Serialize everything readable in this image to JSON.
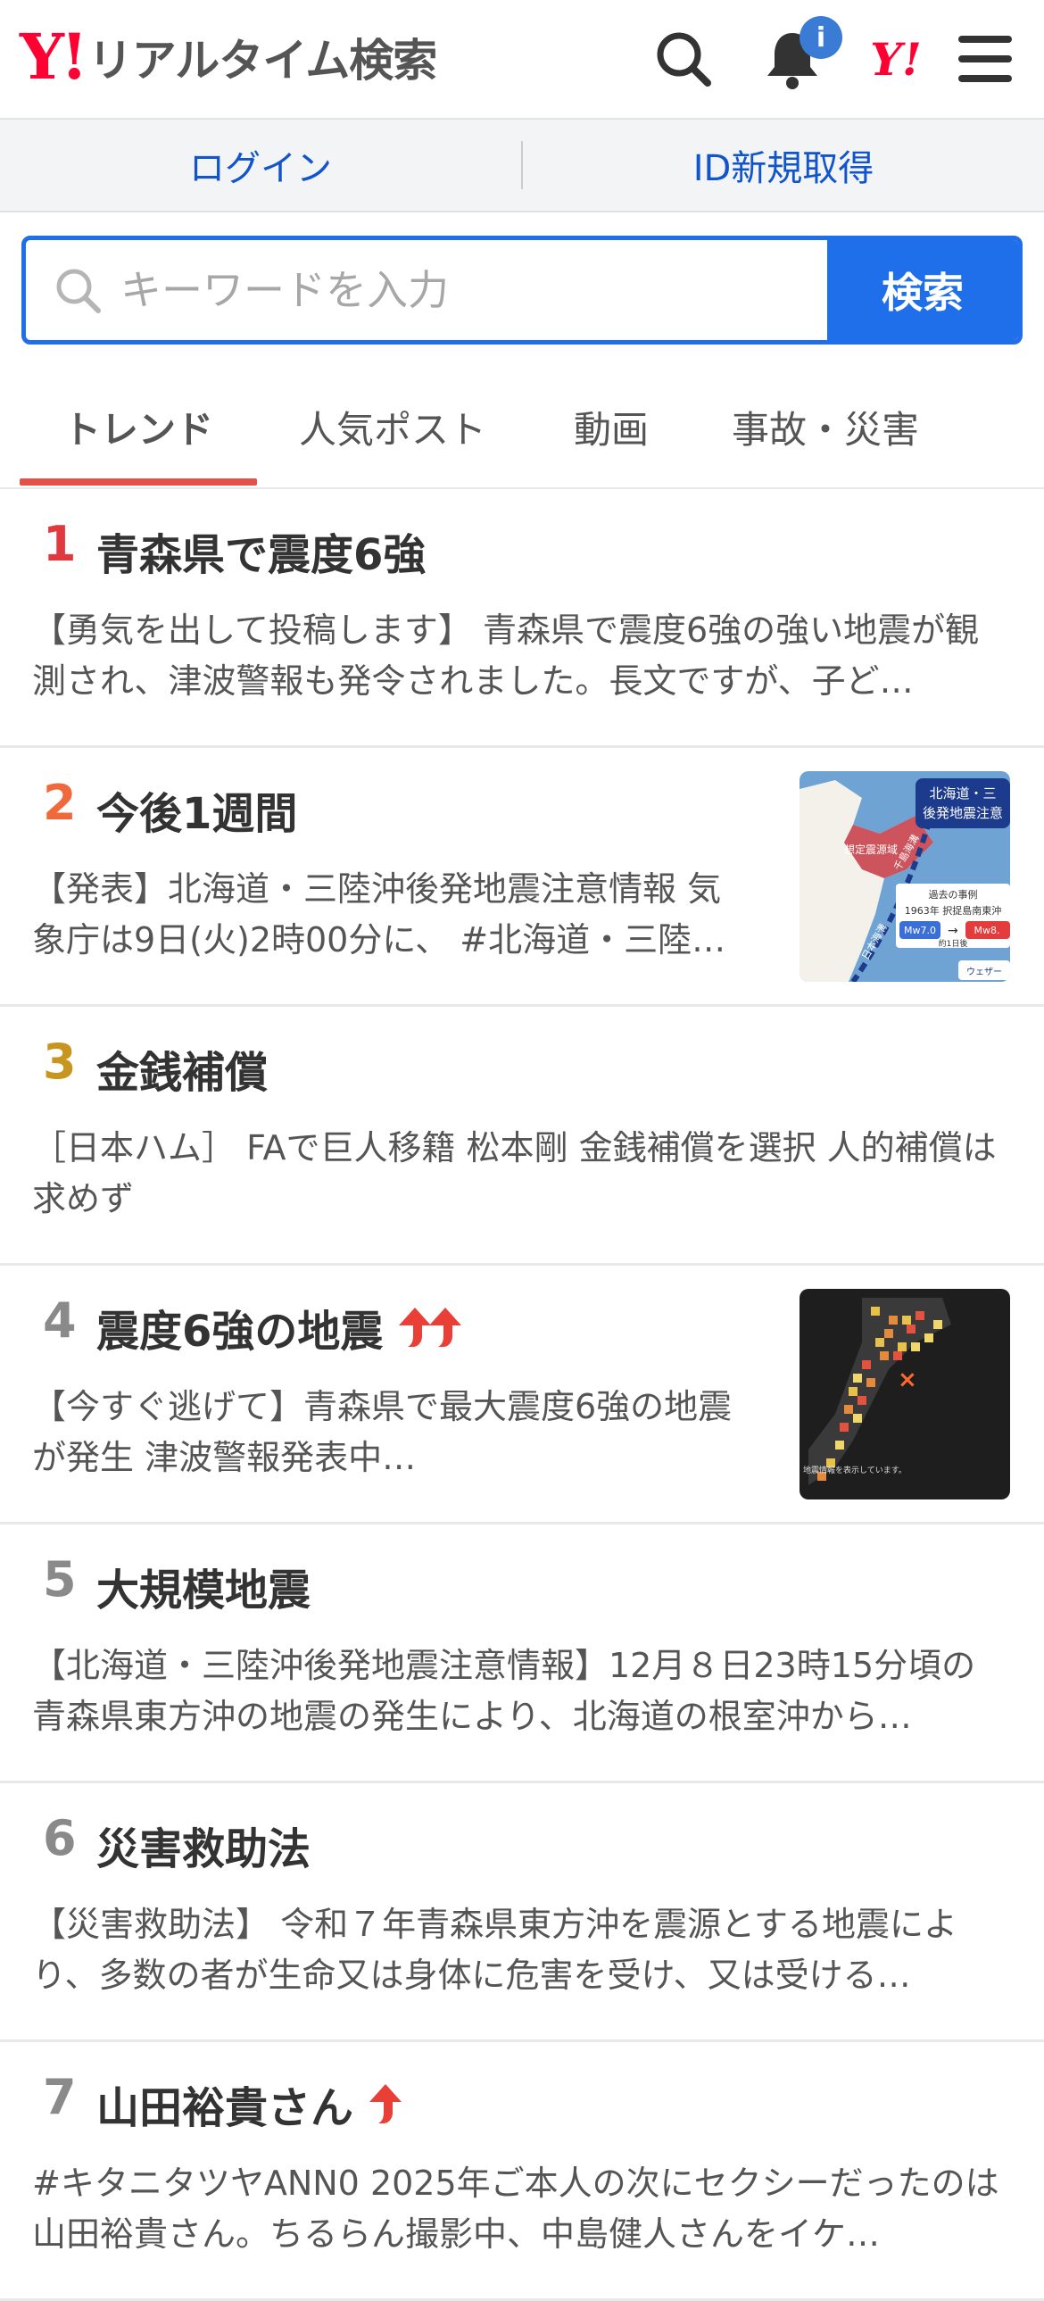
{
  "header": {
    "logo_mark": "Y!",
    "logo_text": "リアルタイム検索",
    "notification_badge": "i",
    "yahoo_small": "Y!"
  },
  "login_bar": {
    "login": "ログイン",
    "register": "ID新規取得"
  },
  "search": {
    "placeholder": "キーワードを入力",
    "button": "検索"
  },
  "tabs": [
    {
      "label": "トレンド",
      "active": true
    },
    {
      "label": "人気ポスト",
      "active": false
    },
    {
      "label": "動画",
      "active": false
    },
    {
      "label": "事故・災害",
      "active": false
    }
  ],
  "colors": {
    "accent": "#1f6feb",
    "brand_red": "#ff0033",
    "rank1": "#e0393e",
    "rank2": "#f0693c",
    "rank3": "#c8961e",
    "rank_other": "#8a8a8a",
    "trend_arrow": "#ea3f36"
  },
  "trends": [
    {
      "rank": "1",
      "title": "青森県で震度6強",
      "desc": "【勇気を出して投稿します】 青森県で震度6強の強い地震が観測され、津波警報も発令されました。長文ですが、子ど…",
      "arrows": 0,
      "thumb": "none"
    },
    {
      "rank": "2",
      "title": "今後1週間",
      "desc": "【発表】北海道・三陸沖後発地震注意情報 気象庁は9日(火)2時00分に、 #北海道・三陸…",
      "arrows": 0,
      "thumb": "map"
    },
    {
      "rank": "3",
      "title": "金銭補償",
      "desc": "［日本ハム］ FAで巨人移籍 松本剛 金銭補償を選択 人的補償は求めず",
      "arrows": 0,
      "thumb": "none"
    },
    {
      "rank": "4",
      "title": "震度6強の地震",
      "desc": "【今すぐ逃げて】青森県で最大震度6強の地震が発生 津波警報発表中…",
      "arrows": 2,
      "thumb": "quake"
    },
    {
      "rank": "5",
      "title": "大規模地震",
      "desc": "【北海道・三陸沖後発地震注意情報】12月８日23時15分頃の青森県東方沖の地震の発生により、北海道の根室沖から…",
      "arrows": 0,
      "thumb": "none"
    },
    {
      "rank": "6",
      "title": "災害救助法",
      "desc": "【災害救助法】 令和７年青森県東方沖を震源とする地震により、多数の者が生命又は身体に危害を受け、又は受ける…",
      "arrows": 0,
      "thumb": "none"
    },
    {
      "rank": "7",
      "title": "山田裕貴さん",
      "desc": "#キタニタツヤANN0 2025年ご本人の次にセクシーだったのは山田裕貴さん。ちるらん撮影中、中島健人さんをイケ…",
      "arrows": 1,
      "thumb": "none"
    }
  ],
  "thumb_map": {
    "badge_line1": "北海道・三",
    "badge_line2": "後発地震注意",
    "region_label": "想定震源域",
    "trench1": "千島海溝",
    "trench2": "日本海溝",
    "past_label": "過去の事例",
    "past_event": "1963年 択捉島南東沖",
    "mag_left": "Mw7.0",
    "mag_right": "Mw8.",
    "footer": "約1日後",
    "brand": "ウェザー"
  },
  "thumb_quake": {
    "caption": "地震情報を表示しています。"
  }
}
